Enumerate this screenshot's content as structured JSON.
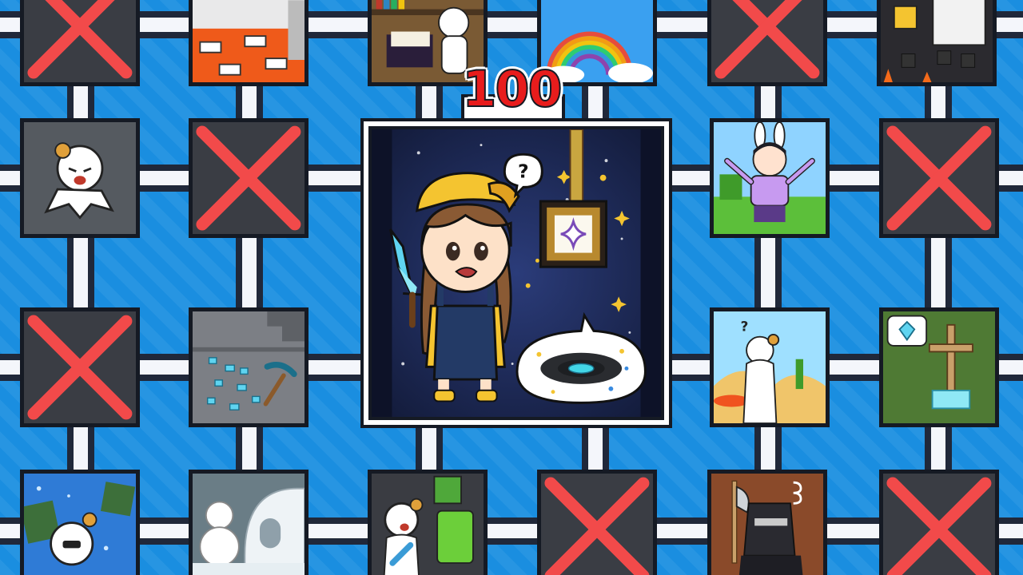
{
  "badge": {
    "number": "100"
  },
  "colors": {
    "background": "#1a8ee0",
    "road": "#f4f6fb",
    "locked_tile": "#3a3d44",
    "cross": "#f24a4a",
    "badge_text": "#e81c1c"
  },
  "tiles": [
    {
      "id": "locked",
      "state": "locked"
    },
    {
      "id": "lava-parkour",
      "state": "unlocked"
    },
    {
      "id": "library-book",
      "state": "unlocked"
    },
    {
      "id": "double-rainbow",
      "state": "unlocked"
    },
    {
      "id": "locked",
      "state": "locked"
    },
    {
      "id": "blaze-fortress",
      "state": "unlocked"
    },
    {
      "id": "screaming-bear",
      "state": "unlocked"
    },
    {
      "id": "locked",
      "state": "locked"
    },
    {
      "id": "bunny-girl-cheer",
      "state": "unlocked"
    },
    {
      "id": "locked",
      "state": "locked"
    },
    {
      "id": "locked",
      "state": "locked"
    },
    {
      "id": "diamond-ore-pickaxe",
      "state": "unlocked"
    },
    {
      "id": "desert-question",
      "state": "unlocked"
    },
    {
      "id": "diamond-sign-grave",
      "state": "unlocked"
    },
    {
      "id": "bee-attack",
      "state": "unlocked"
    },
    {
      "id": "snowman-igloo",
      "state": "unlocked"
    },
    {
      "id": "creeper-scare",
      "state": "unlocked"
    },
    {
      "id": "locked",
      "state": "locked"
    },
    {
      "id": "enderman-axe",
      "state": "unlocked"
    },
    {
      "id": "locked",
      "state": "locked"
    }
  ],
  "center": {
    "scene": "girl-with-diamond-sword-and-music-disc",
    "speech_bubble": "?"
  }
}
